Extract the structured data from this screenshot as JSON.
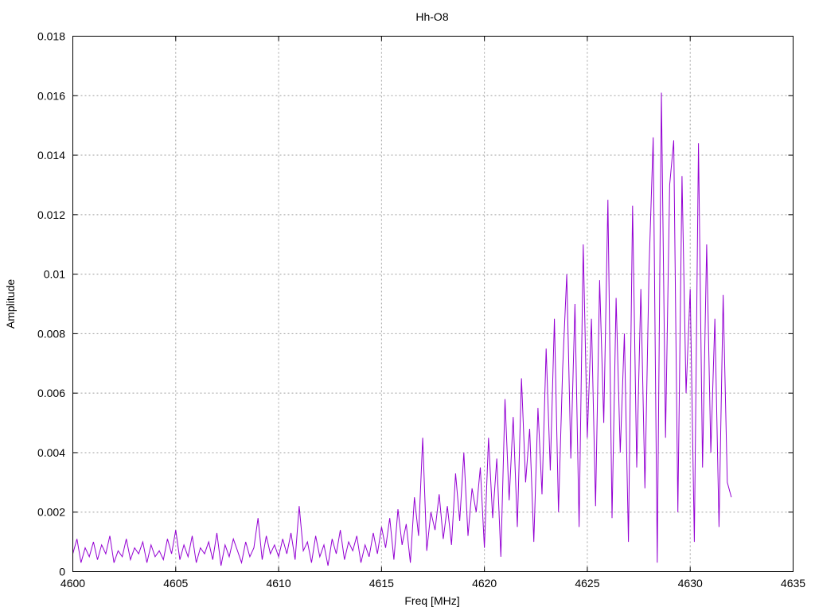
{
  "chart_data": {
    "type": "line",
    "title": "Hh-O8",
    "xlabel": "Freq [MHz]",
    "ylabel": "Amplitude",
    "xlim": [
      4600,
      4635
    ],
    "ylim": [
      0,
      0.018
    ],
    "grid": true,
    "legend": "none",
    "color": "#9400d3",
    "xticks": [
      "4600",
      "4605",
      "4610",
      "4615",
      "4620",
      "4625",
      "4630",
      "4635"
    ],
    "yticks": [
      "0",
      "0.002",
      "0.004",
      "0.006",
      "0.008",
      "0.01",
      "0.012",
      "0.014",
      "0.016",
      "0.018"
    ],
    "x_start": 4600,
    "x_step": 0.2,
    "values": [
      0.0006,
      0.0011,
      0.0003,
      0.0008,
      0.0005,
      0.001,
      0.0004,
      0.0009,
      0.0006,
      0.0012,
      0.0003,
      0.0007,
      0.0005,
      0.0011,
      0.0004,
      0.0008,
      0.0006,
      0.001,
      0.0003,
      0.0009,
      0.0005,
      0.0007,
      0.0004,
      0.0011,
      0.0006,
      0.0014,
      0.0004,
      0.0009,
      0.0005,
      0.0012,
      0.0003,
      0.0008,
      0.0006,
      0.001,
      0.0004,
      0.0013,
      0.0002,
      0.0009,
      0.0005,
      0.0011,
      0.0007,
      0.0003,
      0.001,
      0.0005,
      0.0008,
      0.0018,
      0.0004,
      0.0012,
      0.0006,
      0.0009,
      0.0005,
      0.0011,
      0.0006,
      0.0013,
      0.0004,
      0.0022,
      0.0007,
      0.001,
      0.0003,
      0.0012,
      0.0005,
      0.0009,
      0.0002,
      0.0011,
      0.0006,
      0.0014,
      0.0004,
      0.001,
      0.0007,
      0.0012,
      0.0003,
      0.0009,
      0.0005,
      0.0013,
      0.0006,
      0.0015,
      0.0008,
      0.0018,
      0.0004,
      0.0021,
      0.0009,
      0.0016,
      0.0003,
      0.0025,
      0.0012,
      0.0045,
      0.0007,
      0.002,
      0.0014,
      0.0026,
      0.0011,
      0.0022,
      0.0009,
      0.0033,
      0.0017,
      0.004,
      0.0012,
      0.0028,
      0.002,
      0.0035,
      0.0008,
      0.0045,
      0.0018,
      0.0038,
      0.0005,
      0.0058,
      0.0024,
      0.0052,
      0.0015,
      0.0065,
      0.003,
      0.0048,
      0.001,
      0.0055,
      0.0026,
      0.0075,
      0.0034,
      0.0085,
      0.002,
      0.0068,
      0.01,
      0.0038,
      0.009,
      0.0015,
      0.011,
      0.0045,
      0.0085,
      0.0022,
      0.0098,
      0.005,
      0.0125,
      0.0018,
      0.0092,
      0.004,
      0.008,
      0.001,
      0.0123,
      0.0035,
      0.0095,
      0.0028,
      0.0102,
      0.0146,
      0.0003,
      0.0161,
      0.0045,
      0.013,
      0.0145,
      0.002,
      0.0133,
      0.006,
      0.0095,
      0.001,
      0.0144,
      0.0035,
      0.011,
      0.004,
      0.0085,
      0.0015,
      0.0093,
      0.003,
      0.0025
    ]
  }
}
